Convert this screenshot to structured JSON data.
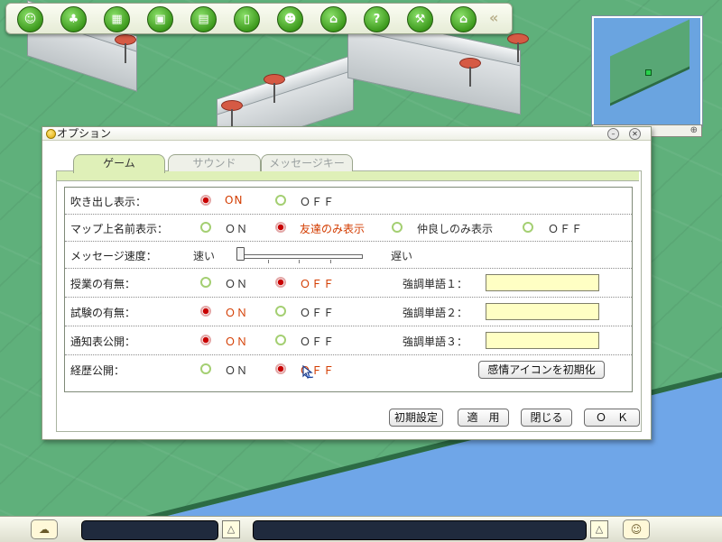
{
  "toolbar": {
    "buttons": [
      {
        "icon": "profile-icon",
        "glyph": "☺"
      },
      {
        "icon": "character-icon",
        "glyph": "♣"
      },
      {
        "icon": "clapperboard-icon",
        "glyph": "▦"
      },
      {
        "icon": "gift-box-icon",
        "glyph": "▣"
      },
      {
        "icon": "whiteboard-icon",
        "glyph": "▤"
      },
      {
        "icon": "phone-icon",
        "glyph": "▯"
      },
      {
        "icon": "friends-icon",
        "glyph": "☻"
      },
      {
        "icon": "school-icon",
        "glyph": "⌂"
      },
      {
        "icon": "help-icon",
        "glyph": "?"
      },
      {
        "icon": "tools-icon",
        "glyph": "⚒"
      },
      {
        "icon": "home-icon",
        "glyph": "⌂"
      }
    ],
    "collapse_glyph": "«"
  },
  "minimap": {
    "zoom_glyph": "⊕"
  },
  "window": {
    "title": "オプション",
    "minimize_glyph": "–",
    "close_glyph": "✕",
    "tabs": [
      {
        "label": "ゲーム",
        "active": true
      },
      {
        "label": "サウンド",
        "active": false
      },
      {
        "label": "メッセージキー",
        "active": false
      }
    ],
    "rows": {
      "balloon": {
        "label": "吹き出し表示：",
        "on": "ON",
        "off": "ＯＦＦ",
        "selected": "on"
      },
      "map_names": {
        "label": "マップ上名前表示：",
        "options": [
          "ＯＮ",
          "友達のみ表示",
          "仲良しのみ表示",
          "ＯＦＦ"
        ],
        "selected_index": 1
      },
      "message_speed": {
        "label": "メッセージ速度：",
        "fast": "速い",
        "slow": "遅い",
        "value_fraction": 0.0
      },
      "class": {
        "label": "授業の有無：",
        "on": "ＯＮ",
        "off": "ＯＦＦ",
        "selected": "off",
        "kw_label": "強調単語１：",
        "kw_value": ""
      },
      "exam": {
        "label": "試験の有無：",
        "on": "ＯＮ",
        "off": "ＯＦＦ",
        "selected": "on",
        "kw_label": "強調単語２：",
        "kw_value": ""
      },
      "report": {
        "label": "通知表公開：",
        "on": "ＯＮ",
        "off": "ＯＦＦ",
        "selected": "on",
        "kw_label": "強調単語３：",
        "kw_value": ""
      },
      "history": {
        "label": "経歴公開：",
        "on": "ＯＮ",
        "off": "ＯＦＦ",
        "selected": "off",
        "button": "感情アイコンを初期化"
      }
    },
    "buttons": {
      "defaults": "初期設定",
      "apply": "適　用",
      "close": "閉じる",
      "ok": "Ｏ　Ｋ"
    }
  },
  "bottombar": {
    "left_icon_glyph": "☁",
    "right_icon_glyph": "☺",
    "up_glyph": "△"
  },
  "colors": {
    "selected_text": "#d33c00",
    "tab_active": "#dff0b8",
    "keyword_field": "#ffffc4"
  }
}
